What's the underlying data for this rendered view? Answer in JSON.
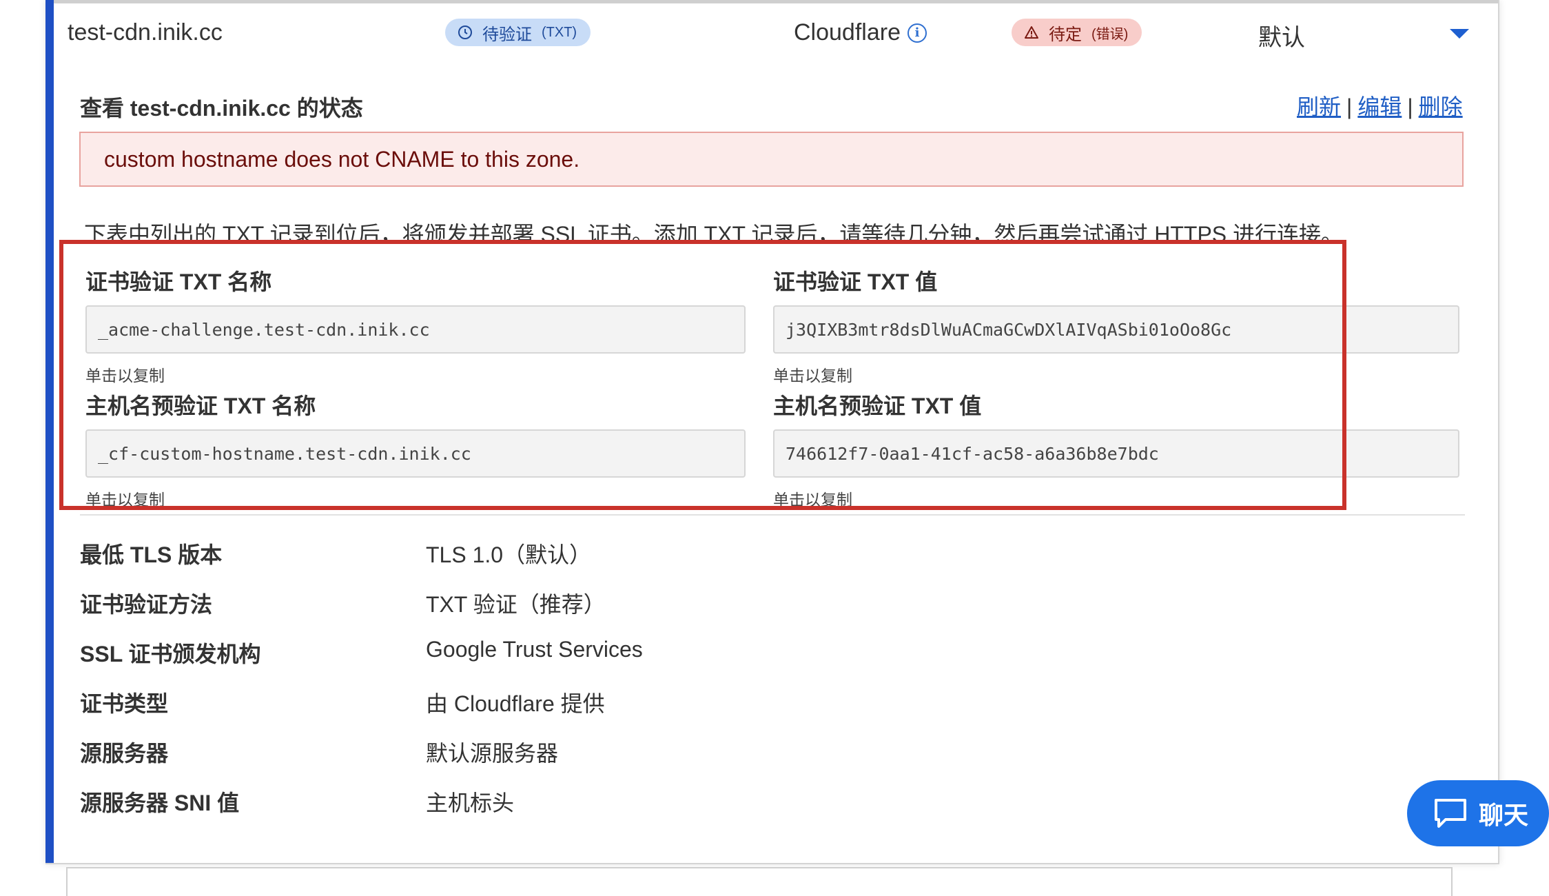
{
  "header": {
    "hostname": "test-cdn.inik.cc",
    "verify_badge": "待验证",
    "verify_badge_sub": "(TXT)",
    "provider": "Cloudflare",
    "pending_badge": "待定",
    "pending_badge_sub": "(错误)",
    "default_label": "默认"
  },
  "status": {
    "title": "查看 test-cdn.inik.cc 的状态",
    "actions": {
      "refresh": "刷新",
      "edit": "编辑",
      "delete": "删除",
      "separator": "|"
    },
    "error_message": "custom hostname does not CNAME to this zone.",
    "description": "下表中列出的 TXT 记录到位后，将颁发并部署 SSL 证书。添加 TXT 记录后，请等待几分钟，然后再尝试通过 HTTPS 进行连接。"
  },
  "records": {
    "cert_name_label": "证书验证 TXT 名称",
    "cert_name_value": "_acme-challenge.test-cdn.inik.cc",
    "cert_value_label": "证书验证 TXT 值",
    "cert_value_value": "j3QIXB3mtr8dsDlWuACmaGCwDXlAIVqASbi01oOo8Gc",
    "host_name_label": "主机名预验证 TXT 名称",
    "host_name_value": "_cf-custom-hostname.test-cdn.inik.cc",
    "host_value_label": "主机名预验证 TXT 值",
    "host_value_value": "746612f7-0aa1-41cf-ac58-a6a36b8e7bdc",
    "copy_hint": "单击以复制"
  },
  "details": [
    {
      "label": "最低 TLS 版本",
      "value": "TLS 1.0（默认）"
    },
    {
      "label": "证书验证方法",
      "value": "TXT 验证（推荐）"
    },
    {
      "label": "SSL 证书颁发机构",
      "value": "Google Trust Services"
    },
    {
      "label": "证书类型",
      "value": "由 Cloudflare 提供"
    },
    {
      "label": "源服务器",
      "value": "默认源服务器"
    },
    {
      "label": "源服务器 SNI 值",
      "value": "主机标头"
    }
  ],
  "chat": {
    "label": "聊天"
  },
  "colors": {
    "accent": "#1e4fc4",
    "link": "#1f5ec5",
    "highlight_border": "#c9322b",
    "error_bg": "#fcebea",
    "chat_bg": "#1e73e8"
  }
}
